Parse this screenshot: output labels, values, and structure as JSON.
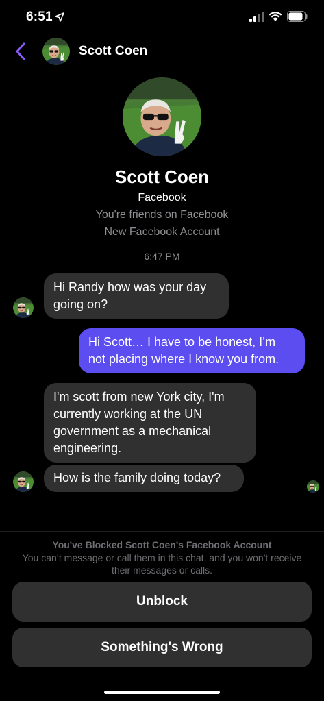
{
  "status_bar": {
    "time": "6:51"
  },
  "header": {
    "contact_name": "Scott Coen"
  },
  "profile": {
    "name": "Scott Coen",
    "source": "Facebook",
    "relation": "You're friends on Facebook",
    "note": "New Facebook Account"
  },
  "thread": {
    "timestamp": "6:47 PM",
    "messages": [
      {
        "direction": "incoming",
        "text": "Hi Randy how was your day going on?"
      },
      {
        "direction": "outgoing",
        "text": "Hi Scott… I have to be honest, I’m not placing where I know you from."
      },
      {
        "direction": "incoming",
        "text": "I'm scott from new York city, I'm currently working at the UN government as a mechanical engineering."
      },
      {
        "direction": "incoming",
        "text": "How is the family doing today?"
      }
    ]
  },
  "blocked": {
    "title": "You've Blocked Scott Coen's Facebook Account",
    "description": "You can’t message or call them in this chat, and you won't receive their messages or calls."
  },
  "actions": {
    "unblock_label": "Unblock",
    "something_wrong_label": "Something's Wrong"
  },
  "colors": {
    "accent": "#8b5cf6",
    "outgoing_bubble": "#5b4df0",
    "incoming_bubble": "#303030",
    "background": "#000000"
  },
  "icons": [
    "location-arrow-icon",
    "signal-icon",
    "wifi-icon",
    "battery-icon",
    "back-chevron-icon"
  ]
}
